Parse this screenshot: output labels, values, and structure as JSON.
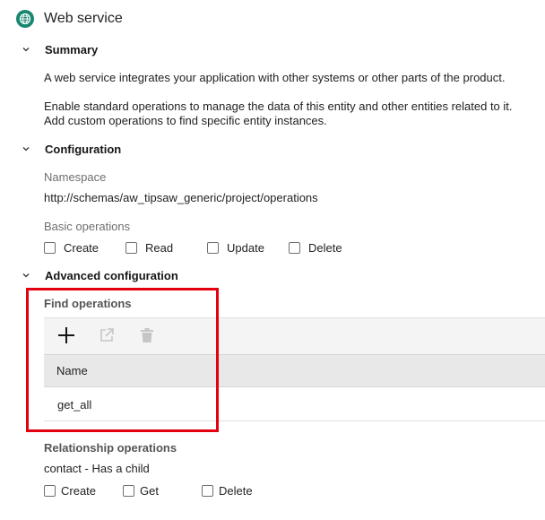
{
  "header": {
    "title": "Web service",
    "icon": "web-service-globe-icon",
    "icon_color": "#17876f"
  },
  "summary": {
    "title": "Summary",
    "text1": "A web service integrates your application with other systems or other parts of the product.",
    "text2_line1": "Enable standard operations to manage the data of this entity and other entities related to it.",
    "text2_line2": "Add custom operations to find specific entity instances."
  },
  "configuration": {
    "title": "Configuration",
    "namespace_label": "Namespace",
    "namespace_value": "http://schemas/aw_tipsaw_generic/project/operations",
    "basic_ops_label": "Basic operations",
    "basic_ops": [
      {
        "label": "Create",
        "checked": false
      },
      {
        "label": "Read",
        "checked": false
      },
      {
        "label": "Update",
        "checked": false
      },
      {
        "label": "Delete",
        "checked": false
      }
    ]
  },
  "advanced": {
    "title": "Advanced configuration",
    "find_ops_label": "Find operations",
    "toolbar": {
      "add_icon": "plus-icon",
      "open_icon": "open-external-icon",
      "delete_icon": "trash-icon"
    },
    "table": {
      "columns": [
        "Name"
      ],
      "rows": [
        {
          "name": "get_all"
        }
      ]
    },
    "relationship_label": "Relationship operations",
    "relationship_entity": "contact - Has a child",
    "relationship_ops": [
      {
        "label": "Create",
        "checked": false
      },
      {
        "label": "Get",
        "checked": false
      },
      {
        "label": "Delete",
        "checked": false
      }
    ]
  },
  "colors": {
    "highlight": "#e3000f",
    "accent": "#17876f"
  }
}
